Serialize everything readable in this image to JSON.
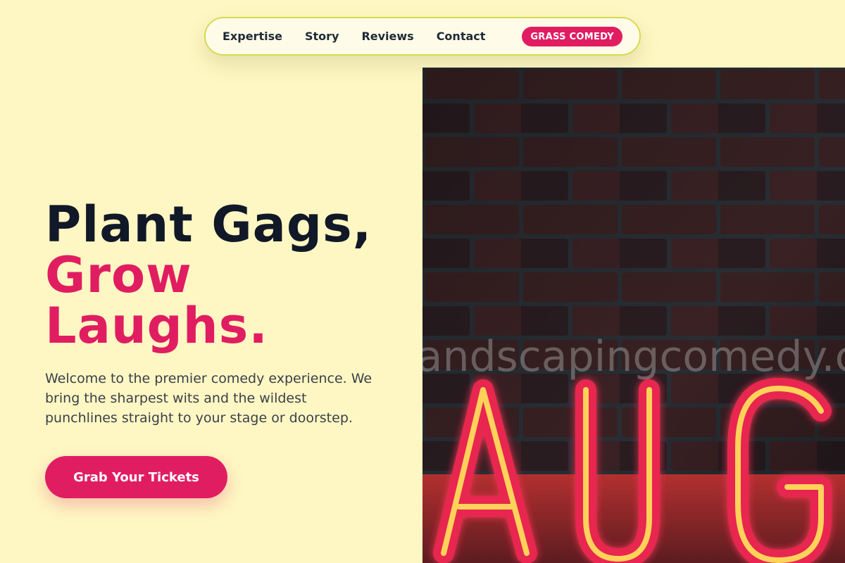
{
  "nav": {
    "links": [
      "Expertise",
      "Story",
      "Reviews",
      "Contact"
    ],
    "brand": "GRASS COMEDY"
  },
  "hero": {
    "title_line1": "Plant Gags,",
    "title_line2": "Grow",
    "title_line3": "Laughs.",
    "subtitle": "Welcome to the premier comedy experience. We bring the sharpest wits and the wildest punchlines straight to your stage or doorstep.",
    "cta_label": "Grab Your Tickets"
  },
  "image": {
    "alt": "Neon LAUGH sign on a brick wall",
    "watermark": "landscapingcomedy.com",
    "neon_text": "AUG"
  },
  "colors": {
    "background": "#fef7c3",
    "accent": "#e11d61",
    "heading": "#111827",
    "nav_border": "#d4dc52"
  }
}
